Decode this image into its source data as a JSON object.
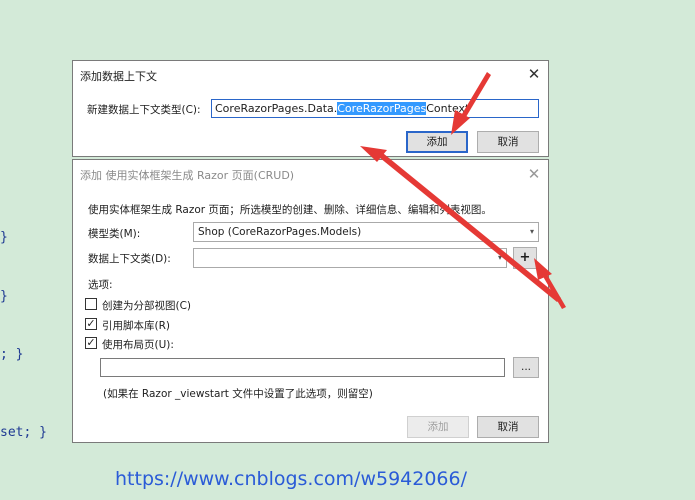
{
  "code_fragments": [
    "}",
    "}",
    "; }",
    "set; }"
  ],
  "dialog_new_context": {
    "title": "添加数据上下文",
    "field_label": "新建数据上下文类型(C):",
    "value_prefix": "CoreRazorPages.Data.",
    "value_selected": "CoreRazorPages",
    "value_suffix": "Context",
    "add_label": "添加",
    "cancel_label": "取消"
  },
  "dialog_scaffold": {
    "title": "添加 使用实体框架生成 Razor 页面(CRUD)",
    "description": "使用实体框架生成 Razor 页面；所选模型的创建、删除、详细信息、编辑和列表视图。",
    "model_label": "模型类(M):",
    "model_value": "Shop (CoreRazorPages.Models)",
    "context_label": "数据上下文类(D):",
    "context_value": "",
    "add_context_button": "+",
    "options_label": "选项:",
    "options": [
      {
        "label": "创建为分部视图(C)",
        "checked": false
      },
      {
        "label": "引用脚本库(R)",
        "checked": true
      },
      {
        "label": "使用布局页(U):",
        "checked": true
      }
    ],
    "layout_path": "",
    "browse_button": "...",
    "hint": "(如果在 Razor _viewstart 文件中设置了此选项，则留空)",
    "add_label": "添加",
    "cancel_label": "取消"
  },
  "watermark_url": "https://www.cnblogs.com/w5942066/",
  "colors": {
    "background": "#d3ead8",
    "selection": "#3399ff",
    "annotation_arrow": "#e53935",
    "url": "#2a5bd7"
  },
  "icons": [
    "close-icon",
    "dropdown-arrow-icon",
    "checkmark-icon",
    "arrow-annotation-icon"
  ]
}
